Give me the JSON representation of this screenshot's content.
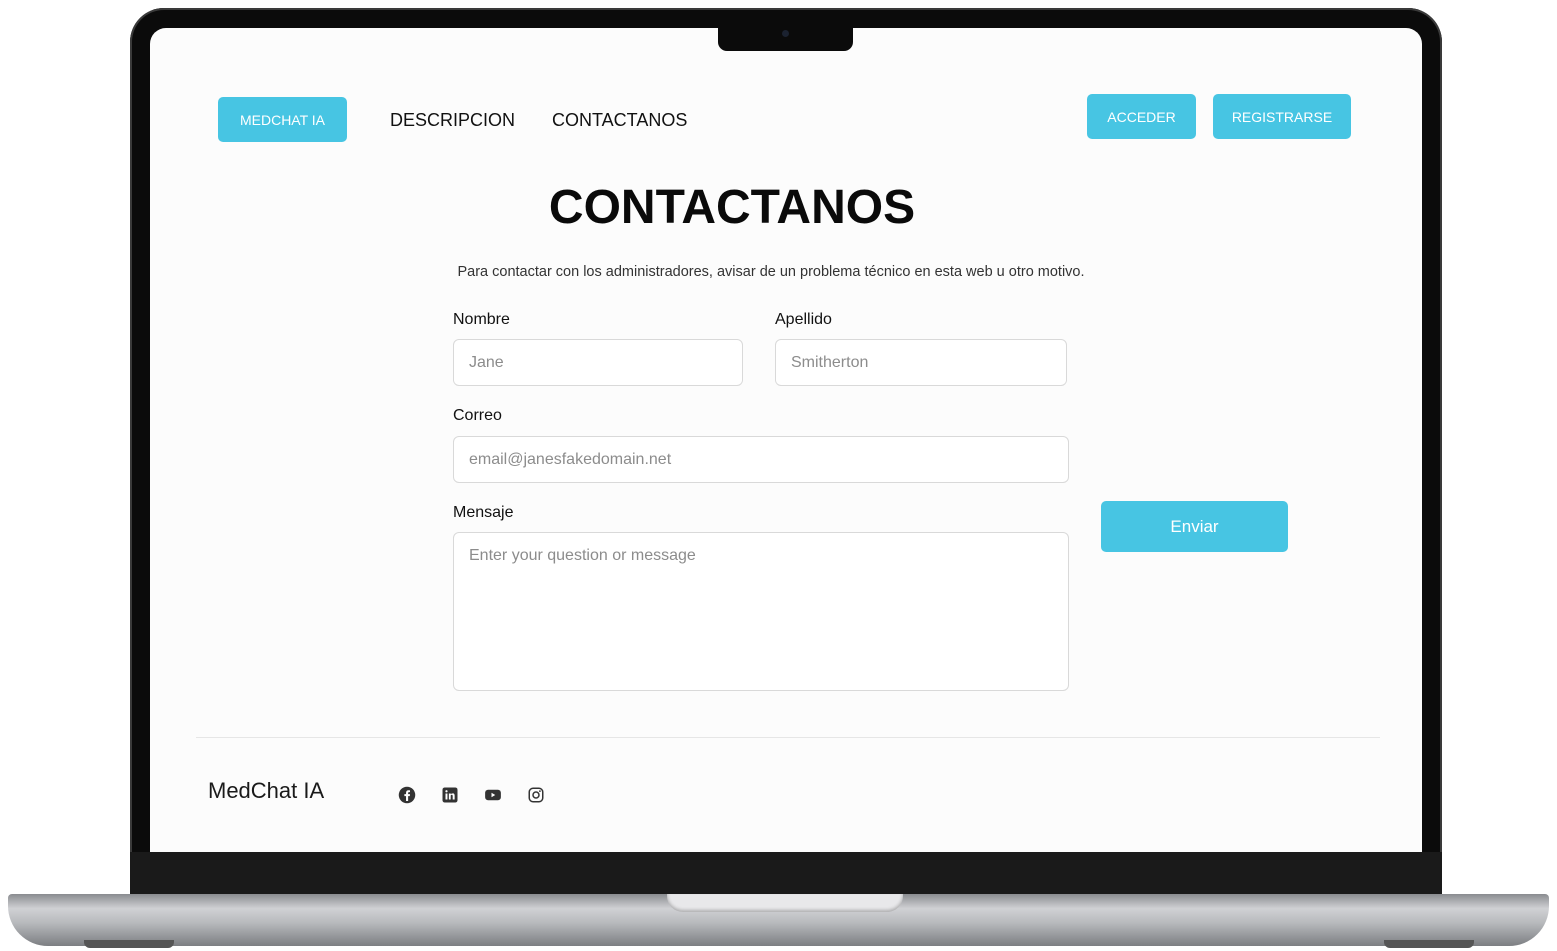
{
  "nav": {
    "brand_label": "MEDCHAT IA",
    "links": [
      "DESCRIPCION",
      "CONTACTANOS"
    ],
    "login_label": "ACCEDER",
    "register_label": "REGISTRARSE"
  },
  "main": {
    "title": "CONTACTANOS",
    "subtitle": "Para contactar con los administradores, avisar de un problema técnico en esta web u otro motivo.",
    "form": {
      "first_name_label": "Nombre",
      "first_name_placeholder": "Jane",
      "last_name_label": "Apellido",
      "last_name_placeholder": "Smitherton",
      "email_label": "Correo",
      "email_placeholder": "email@janesfakedomain.net",
      "message_label": "Mensaje",
      "message_placeholder": "Enter your question or message",
      "submit_label": "Enviar"
    }
  },
  "footer": {
    "brand": "MedChat IA",
    "social_icons": [
      "facebook-icon",
      "linkedin-icon",
      "youtube-icon",
      "instagram-icon"
    ]
  },
  "colors": {
    "accent": "#47c5e3",
    "text": "#111111",
    "placeholder": "#8c8c8c"
  }
}
